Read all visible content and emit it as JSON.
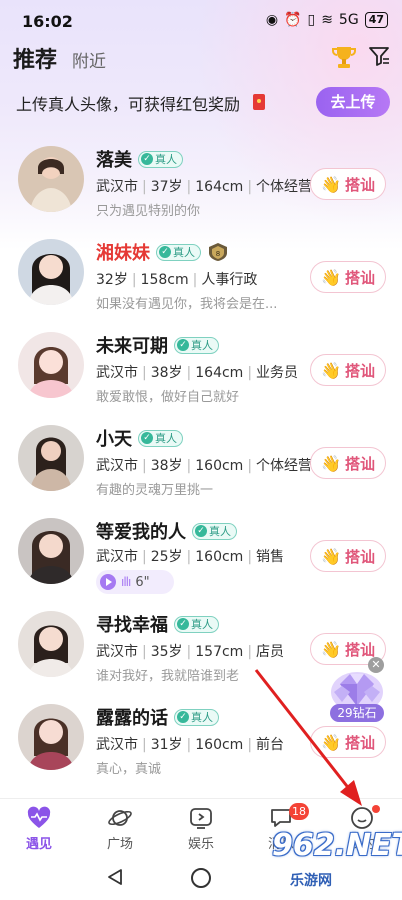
{
  "status_bar": {
    "time": "16:02",
    "network": "5G",
    "battery": "47"
  },
  "header": {
    "tab_recommend": "推荐",
    "tab_nearby": "附近"
  },
  "banner": {
    "text": "上传真人头像，可获得红包奖励",
    "button": "去上传"
  },
  "verified_label": "真人",
  "greet_label": "搭讪",
  "users": [
    {
      "name": "落美",
      "info": [
        "武汉市",
        "37岁",
        "164cm",
        "个体经营"
      ],
      "bio": "只为遇见特别的你",
      "red": false
    },
    {
      "name": "湘妹妹",
      "info": [
        "32岁",
        "158cm",
        "人事行政"
      ],
      "bio": "如果没有遇见你，我将会是在...",
      "red": true
    },
    {
      "name": "未来可期",
      "info": [
        "武汉市",
        "38岁",
        "164cm",
        "业务员"
      ],
      "bio": "敢爱敢恨，做好自己就好",
      "red": false
    },
    {
      "name": "小天",
      "info": [
        "武汉市",
        "38岁",
        "160cm",
        "个体经营"
      ],
      "bio": "有趣的灵魂万里挑一",
      "red": false
    },
    {
      "name": "等爱我的人",
      "info": [
        "武汉市",
        "25岁",
        "160cm",
        "销售"
      ],
      "bio": "",
      "voice": "6\"",
      "red": false
    },
    {
      "name": "寻找幸福",
      "info": [
        "武汉市",
        "35岁",
        "157cm",
        "店员"
      ],
      "bio": "谁对我好，我就陪谁到老",
      "red": false
    },
    {
      "name": "露露的话",
      "info": [
        "武汉市",
        "31岁",
        "160cm",
        "前台"
      ],
      "bio": "真心，真诚",
      "red": false
    }
  ],
  "floating_reward": {
    "label": "29钻石"
  },
  "bottom_nav": {
    "items": [
      {
        "label": "遇见",
        "icon": "heart-pulse-icon"
      },
      {
        "label": "广场",
        "icon": "planet-icon"
      },
      {
        "label": "娱乐",
        "icon": "play-box-icon"
      },
      {
        "label": "消息",
        "icon": "chat-bubble-icon"
      },
      {
        "label": "我的",
        "icon": "smile-face-icon"
      }
    ],
    "message_badge": "18"
  },
  "watermark": {
    "number": "962.NET",
    "text": "乐游网"
  },
  "colors": {
    "accent": "#8b54e8",
    "greet": "#e0567a",
    "verified": "#36b89a",
    "badge": "#f44336"
  }
}
